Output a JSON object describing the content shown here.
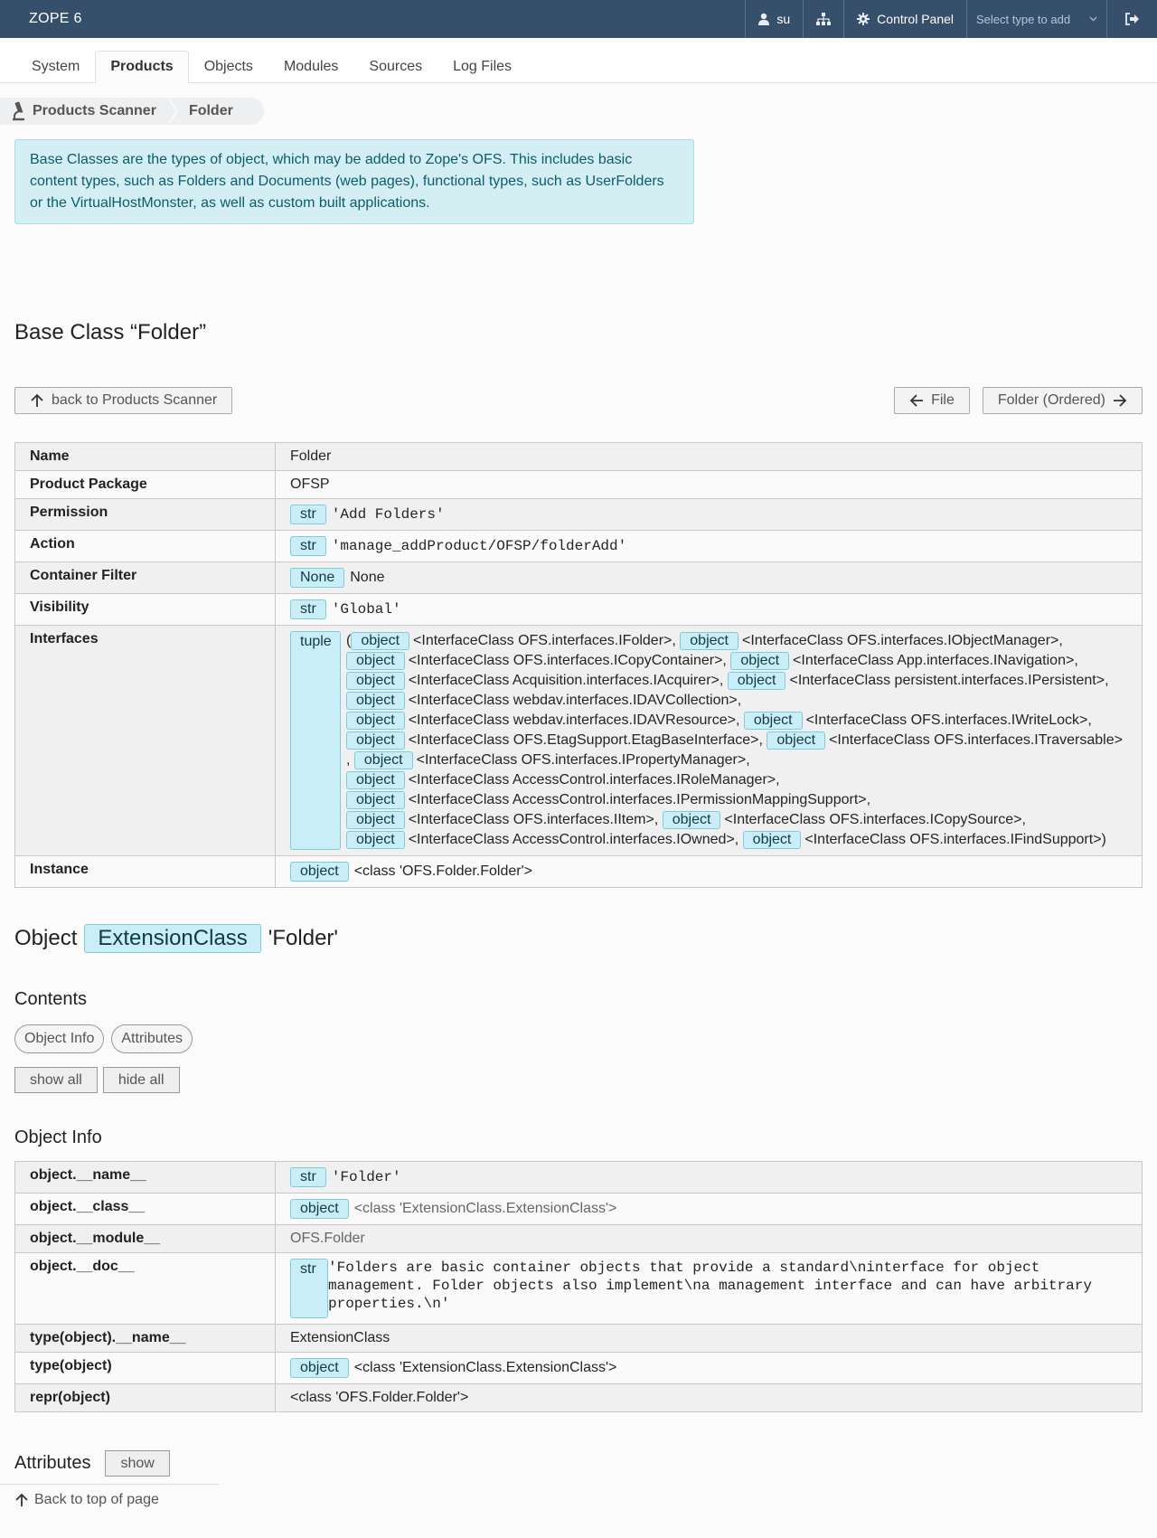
{
  "topbar": {
    "brand": "ZOPE 6",
    "user": "su",
    "control_panel": "Control Panel",
    "select_placeholder": "Select type to add"
  },
  "tabs": [
    "System",
    "Products",
    "Objects",
    "Modules",
    "Sources",
    "Log Files"
  ],
  "breadcrumb": [
    "Products Scanner",
    "Folder"
  ],
  "info": "Base Classes are the types of object, which may be added to Zope's OFS. This includes basic content types, such as Folders and Documents (web pages), functional types, such as UserFolders or the VirtualHostMonster, as well as custom built applications.",
  "title": "Base Class “Folder”",
  "nav": {
    "back": "back to Products Scanner",
    "prev": "File",
    "next": "Folder (Ordered)"
  },
  "props": {
    "name_key": "Name",
    "name_val": "Folder",
    "pkg_key": "Product Package",
    "pkg_val": "OFSP",
    "perm_key": "Permission",
    "perm_type": "str",
    "perm_val": "'Add Folders'",
    "action_key": "Action",
    "action_type": "str",
    "action_val": "'manage_addProduct/OFSP/folderAdd'",
    "filter_key": "Container Filter",
    "filter_type": "None",
    "filter_val": "None",
    "vis_key": "Visibility",
    "vis_type": "str",
    "vis_val": "'Global'",
    "iface_key": "Interfaces",
    "iface_type": "tuple",
    "instance_key": "Instance",
    "instance_type": "object",
    "instance_val": "<class 'OFS.Folder.Folder'>"
  },
  "interfaces": {
    "obj": "object",
    "l1a": "<InterfaceClass OFS.interfaces.IFolder>,",
    "l1b": "<InterfaceClass OFS.interfaces.IObjectManager>,",
    "l2a": "<InterfaceClass OFS.interfaces.ICopyContainer>,",
    "l2b": "<InterfaceClass App.interfaces.INavigation>,",
    "l3a": "<InterfaceClass Acquisition.interfaces.IAcquirer>,",
    "l3b": "<InterfaceClass persistent.interfaces.IPersistent>,",
    "l4a": "<InterfaceClass webdav.interfaces.IDAVCollection>,",
    "l5a": "<InterfaceClass webdav.interfaces.IDAVResource>,",
    "l5b": "<InterfaceClass OFS.interfaces.IWriteLock>,",
    "l6a": "<InterfaceClass OFS.EtagSupport.EtagBaseInterface>,",
    "l6b": "<InterfaceClass OFS.interfaces.ITraversable>",
    "l7a": "<InterfaceClass OFS.interfaces.IPropertyManager>,",
    "l8a": "<InterfaceClass AccessControl.interfaces.IRoleManager>,",
    "l9a": "<InterfaceClass AccessControl.interfaces.IPermissionMappingSupport>,",
    "l10a": "<InterfaceClass OFS.interfaces.IItem>,",
    "l10b": "<InterfaceClass OFS.interfaces.ICopySource>,",
    "l11a": "<InterfaceClass AccessControl.interfaces.IOwned>,",
    "l11b": "<InterfaceClass OFS.interfaces.IFindSupport>)"
  },
  "object_heading": {
    "prefix": "Object",
    "badge": "ExtensionClass",
    "name": "'Folder'"
  },
  "contents": {
    "title": "Contents",
    "pill1": "Object Info",
    "pill2": "Attributes",
    "show_all": "show all",
    "hide_all": "hide all"
  },
  "object_info": {
    "title": "Object Info",
    "name_key": "object.__name__",
    "name_type": "str",
    "name_val": "'Folder'",
    "class_key": "object.__class__",
    "class_type": "object",
    "class_val": "<class 'ExtensionClass.ExtensionClass'>",
    "module_key": "object.__module__",
    "module_val": "OFS.Folder",
    "doc_key": "object.__doc__",
    "doc_type": "str",
    "doc_l1": "'Folders are basic container objects that provide a standard\\ninterface for object",
    "doc_l2": "management. Folder objects also implement\\na management interface and can have arbitrary",
    "doc_l3": "properties.\\n'",
    "tname_key": "type(object).__name__",
    "tname_val": "ExtensionClass",
    "type_key": "type(object)",
    "type_type": "object",
    "type_val": "<class 'ExtensionClass.ExtensionClass'>",
    "repr_key": "repr(object)",
    "repr_val": "<class 'OFS.Folder.Folder'>"
  },
  "attributes": {
    "title": "Attributes",
    "show": "show",
    "back_top": "Back to top of page"
  }
}
